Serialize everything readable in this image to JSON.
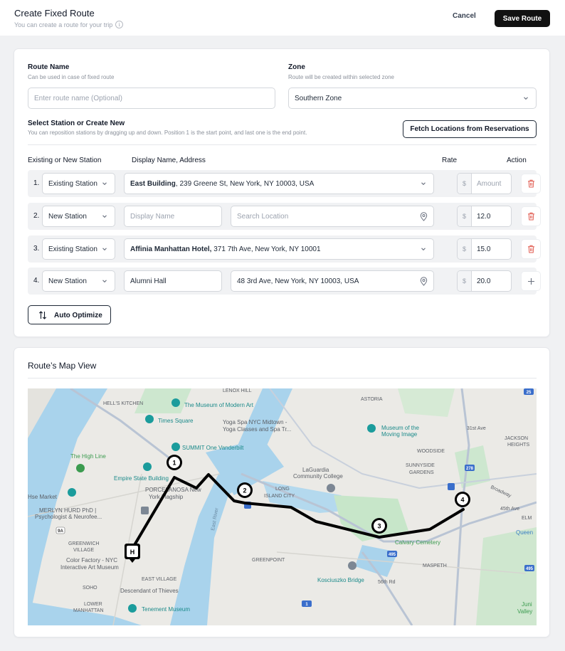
{
  "header": {
    "title": "Create Fixed Route",
    "subtitle": "You can create a route for your trip",
    "info_glyph": "i",
    "cancel_label": "Cancel",
    "save_label": "Save Route"
  },
  "form": {
    "route_name_label": "Route Name",
    "route_name_hint": "Can be used in case of fixed route",
    "route_name_placeholder": "Enter route name (Optional)",
    "zone_label": "Zone",
    "zone_hint": "Route will be created within selected zone",
    "zone_value": "Southern Zone",
    "stations_label": "Select Station or Create New",
    "stations_hint": "You can reposition stations by dragging up and down. Position 1 is the start point, and last one is the end point.",
    "fetch_label": "Fetch Locations from Reservations",
    "columns": {
      "type": "Existing or New Station",
      "display": "Display Name, Address",
      "rate": "Rate",
      "action": "Action"
    },
    "currency_symbol": "$",
    "rows": [
      {
        "num": "1.",
        "type": "Existing Station",
        "name_bold": "East Building",
        "address": ", 239 Greene St, New York, NY 10003, USA",
        "rate_placeholder": "Amount",
        "action_icon": "trash-icon"
      },
      {
        "num": "2.",
        "type": "New Station",
        "display_placeholder": "Display Name",
        "search_placeholder": "Search Location",
        "rate": "12.0",
        "action_icon": "trash-icon"
      },
      {
        "num": "3.",
        "type": "Existing Station",
        "name_bold": "Affinia Manhattan Hotel,",
        "address": " 371 7th Ave, New York, NY 10001",
        "rate": "15.0",
        "action_icon": "trash-icon"
      },
      {
        "num": "4.",
        "type": "New Station",
        "display_value": "Alumni Hall",
        "location_value": "48 3rd Ave, New York, NY 10003, USA",
        "rate": "20.0",
        "action_icon": "plus-icon"
      }
    ],
    "auto_optimize_label": "Auto Optimize"
  },
  "map": {
    "title": "Route’s Map View",
    "markers": [
      "1",
      "2",
      "3",
      "4",
      "H"
    ],
    "labels": {
      "lenox_hill": "LENOX HILL",
      "hells_kitchen": "HELL'S KITCHEN",
      "moma_1": "The Museum of Modern Art",
      "astoria": "ASTORIA",
      "times_square": "Times Square",
      "yoga_1": "Yoga Spa NYC Midtown -",
      "yoga_2": "Yoga Classes and Spa Tr...",
      "moving_image_1": "Museum of the",
      "moving_image_2": "Moving Image",
      "street_31": "31st Ave",
      "jackson_1": "JACKSON",
      "jackson_2": "HEIGHTS",
      "summit": "SUMMIT One Vanderbilt",
      "woodside": "WOODSIDE",
      "high_line": "The High Line",
      "laguardia_1": "LaGuardia",
      "laguardia_2": "Community College",
      "sunnyside_1": "SUNNYSIDE",
      "sunnyside_2": "GARDENS",
      "esb": "Empire State Building",
      "porcelanosa_1": "PORCELANOSA New",
      "porcelanosa_2": "York Flagship",
      "lic_1": "LONG",
      "lic_2": "ISLAND CITY",
      "broadway": "Broadway",
      "hse_market": "Hse Market",
      "merlyn_1": "MERLYN HURD PhD |",
      "merlyn_2": "Psychologist & Neurofee...",
      "east_river": "East River",
      "st_45": "45th Ave",
      "elm": "ELM",
      "queens": "Queen",
      "greenwich_1": "GREENWICH",
      "greenwich_2": "VILLAGE",
      "calvary": "Calvary Cemetery",
      "color_factory_1": "Color Factory - NYC",
      "color_factory_2": "Interactive Art Museum",
      "greenpoint": "GREENPOINT",
      "maspeth": "MASPETH",
      "east_village": "EAST VILLAGE",
      "kosciuszko": "Kosciuszko Bridge",
      "soho": "SOHO",
      "descendant": "Descendant of Thieves",
      "st_56": "56th Rd",
      "lower_1": "LOWER",
      "lower_2": "MANHATTAN",
      "tenement": "Tenement Museum",
      "juni_1": "Juni",
      "juni_2": "Valley",
      "hwy_495": "495",
      "hwy_278": "278",
      "hwy_9a": "9A",
      "hwy_25": "25",
      "hwy_1": "1"
    }
  }
}
